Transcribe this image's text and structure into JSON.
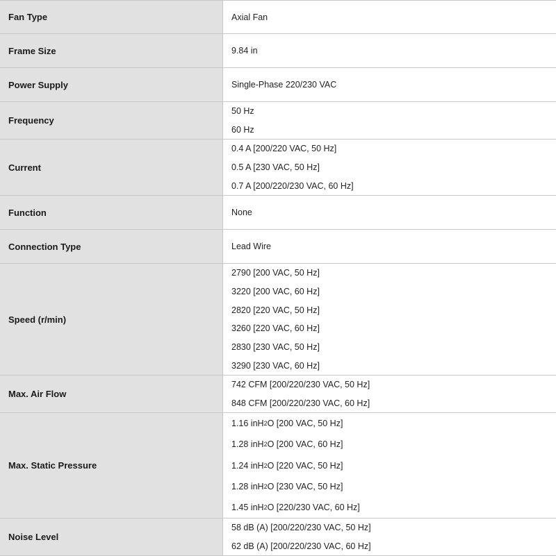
{
  "rows": [
    {
      "label": "Fan Type",
      "values": [
        {
          "text": "Axial Fan"
        }
      ]
    },
    {
      "label": "Frame Size",
      "values": [
        {
          "text": "9.84 in"
        }
      ]
    },
    {
      "label": "Power Supply",
      "values": [
        {
          "text": "Single-Phase 220/230 VAC"
        }
      ]
    },
    {
      "label": "Frequency",
      "values": [
        {
          "text": "50 Hz"
        },
        {
          "text": "60 Hz"
        }
      ]
    },
    {
      "label": "Current",
      "values": [
        {
          "text": "0.4 A [200/220 VAC, 50 Hz]"
        },
        {
          "text": "0.5 A [230 VAC, 50 Hz]"
        },
        {
          "text": "0.7 A [200/220/230 VAC, 60 Hz]"
        }
      ]
    },
    {
      "label": "Function",
      "values": [
        {
          "text": "None"
        }
      ]
    },
    {
      "label": "Connection Type",
      "values": [
        {
          "text": "Lead Wire"
        }
      ]
    },
    {
      "label": "Speed (r/min)",
      "values": [
        {
          "text": "2790 [200 VAC, 50 Hz]"
        },
        {
          "text": "3220 [200 VAC, 60 Hz]"
        },
        {
          "text": "2820 [220 VAC, 50 Hz]"
        },
        {
          "text": "3260 [220 VAC, 60 Hz]"
        },
        {
          "text": "2830 [230 VAC, 50 Hz]"
        },
        {
          "text": "3290 [230 VAC, 60 Hz]"
        }
      ]
    },
    {
      "label": "Max. Air Flow",
      "values": [
        {
          "text": "742 CFM [200/220/230 VAC, 50 Hz]"
        },
        {
          "text": "848 CFM [200/220/230 VAC, 60 Hz]"
        }
      ]
    },
    {
      "label": "Max. Static Pressure",
      "values": [
        {
          "pre": "1.16 inH",
          "sub": "2",
          "post": "O [200 VAC, 50 Hz]"
        },
        {
          "pre": "1.28 inH",
          "sub": "2",
          "post": "O [200 VAC, 60 Hz]"
        },
        {
          "pre": "1.24 inH",
          "sub": "2",
          "post": "O [220 VAC, 50 Hz]"
        },
        {
          "pre": "1.28 inH",
          "sub": "2",
          "post": "O [230 VAC, 50 Hz]"
        },
        {
          "pre": "1.45 inH",
          "sub": "2",
          "post": "O [220/230 VAC, 60 Hz]"
        }
      ]
    },
    {
      "label": "Noise Level",
      "values": [
        {
          "text": "58 dB (A) [200/220/230 VAC, 50 Hz]"
        },
        {
          "text": "62 dB (A) [200/220/230 VAC, 60 Hz]"
        }
      ]
    }
  ]
}
